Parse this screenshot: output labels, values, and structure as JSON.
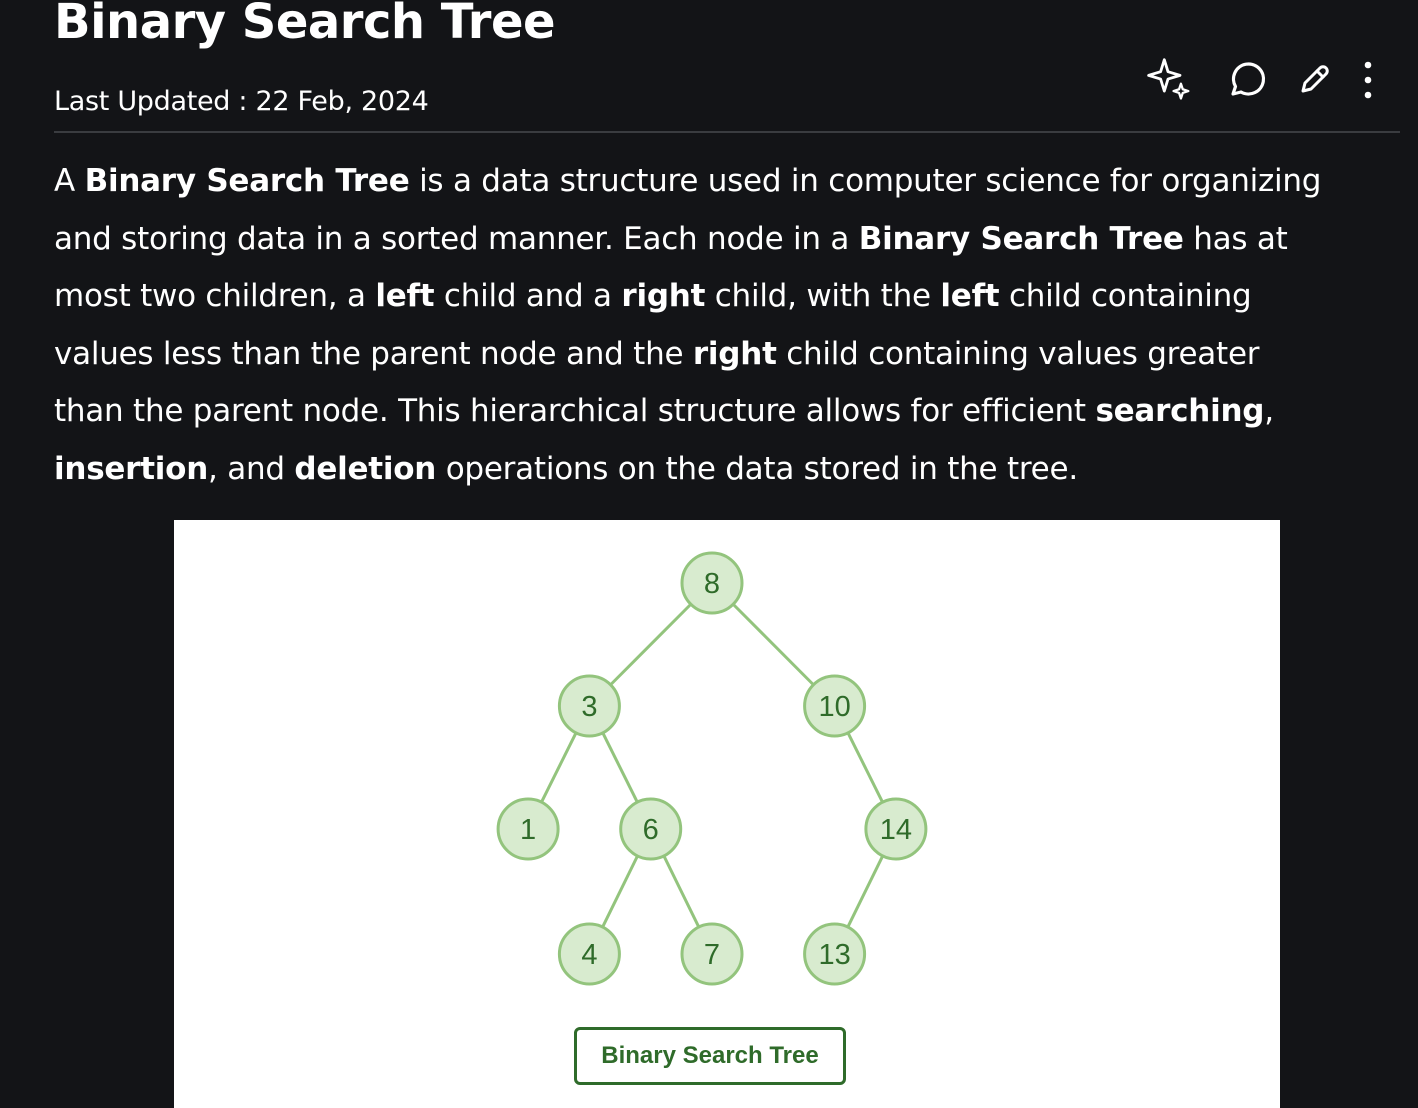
{
  "article": {
    "title": "Binary Search Tree",
    "last_updated_label": "Last Updated : ",
    "last_updated_date": "22 Feb, 2024"
  },
  "toolbar": {
    "icons": [
      "ai-sparkle-icon",
      "comment-icon",
      "edit-pencil-icon",
      "more-options-icon"
    ]
  },
  "intro": {
    "lines": [
      [
        {
          "t": "A "
        },
        {
          "t": "Binary Search Tree",
          "b": true
        },
        {
          "t": " is a data structure used in computer science for organizing"
        }
      ],
      [
        {
          "t": "and storing data in a sorted manner. Each node in a "
        },
        {
          "t": "Binary Search Tree",
          "b": true
        },
        {
          "t": " has at"
        }
      ],
      [
        {
          "t": "most two children, a "
        },
        {
          "t": "left",
          "b": true
        },
        {
          "t": " child and a "
        },
        {
          "t": "right",
          "b": true
        },
        {
          "t": " child, with the "
        },
        {
          "t": "left",
          "b": true
        },
        {
          "t": " child containing"
        }
      ],
      [
        {
          "t": "values less than the parent node and the "
        },
        {
          "t": "right",
          "b": true
        },
        {
          "t": " child containing values greater"
        }
      ],
      [
        {
          "t": "than the parent node. This hierarchical structure allows for efficient "
        },
        {
          "t": "searching",
          "b": true
        },
        {
          "t": ","
        }
      ],
      [
        {
          "t": "insertion",
          "b": true
        },
        {
          "t": ", and "
        },
        {
          "t": "deletion",
          "b": true
        },
        {
          "t": " operations on the data stored in the tree."
        }
      ]
    ]
  },
  "figure": {
    "caption": "Binary Search Tree",
    "colors": {
      "node_fill": "#d8ebcf",
      "node_stroke": "#93c47d",
      "edge": "#93c47d",
      "text": "#2f6b2a"
    },
    "tree": {
      "value": "8",
      "left": {
        "value": "3",
        "left": {
          "value": "1"
        },
        "right": {
          "value": "6",
          "left": {
            "value": "4"
          },
          "right": {
            "value": "7"
          }
        }
      },
      "right": {
        "value": "10",
        "right": {
          "value": "14",
          "left": {
            "value": "13"
          }
        }
      }
    }
  }
}
